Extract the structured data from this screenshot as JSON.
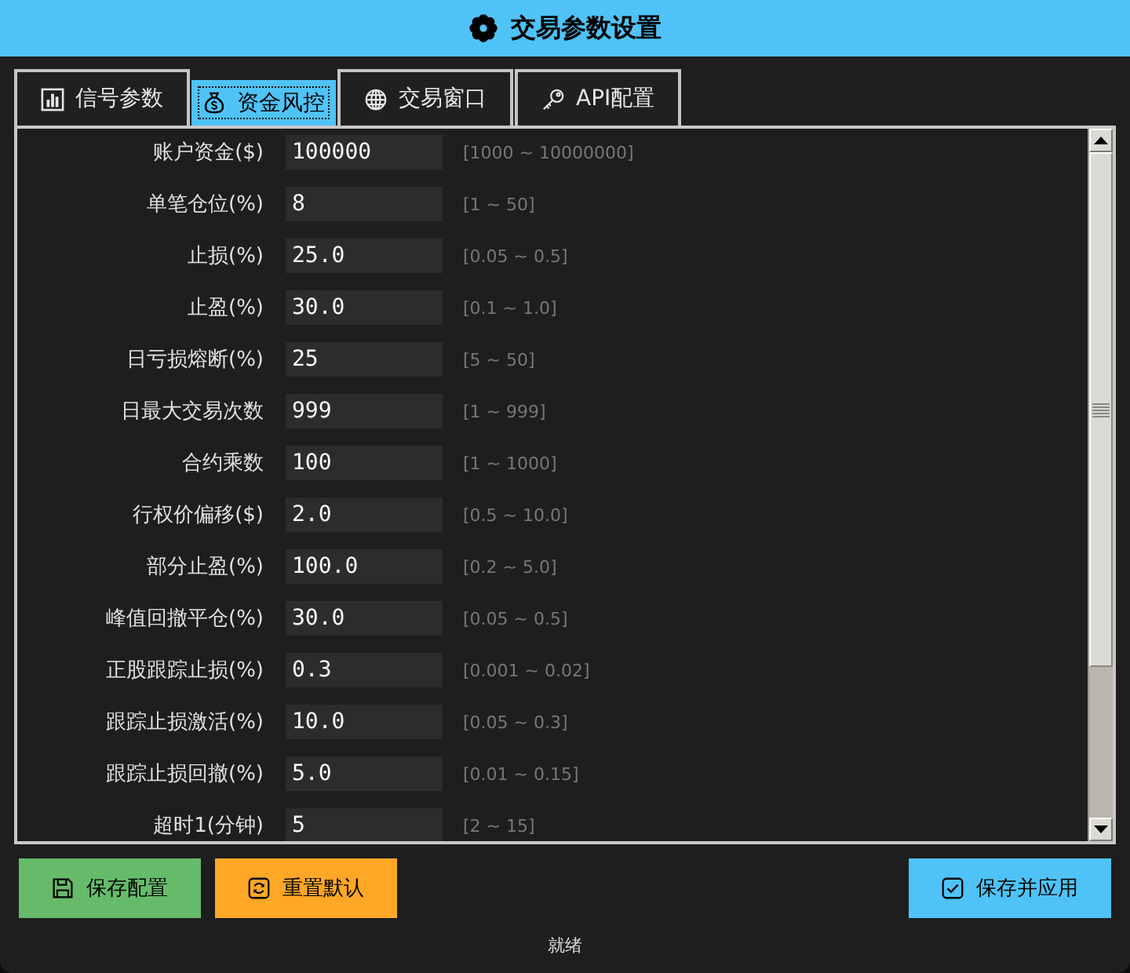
{
  "window": {
    "title": "交易参数设置"
  },
  "tabs": [
    {
      "label": "信号参数",
      "selected": false
    },
    {
      "label": "资金风控",
      "selected": true
    },
    {
      "label": "交易窗口",
      "selected": false
    },
    {
      "label": "API配置",
      "selected": false
    }
  ],
  "fields": [
    {
      "label": "账户资金($)",
      "value": "100000",
      "range": "[1000 ~ 10000000]"
    },
    {
      "label": "单笔仓位(%)",
      "value": "8",
      "range": "[1 ~ 50]"
    },
    {
      "label": "止损(%)",
      "value": "25.0",
      "range": "[0.05 ~ 0.5]"
    },
    {
      "label": "止盈(%)",
      "value": "30.0",
      "range": "[0.1 ~ 1.0]"
    },
    {
      "label": "日亏损熔断(%)",
      "value": "25",
      "range": "[5 ~ 50]"
    },
    {
      "label": "日最大交易次数",
      "value": "999",
      "range": "[1 ~ 999]"
    },
    {
      "label": "合约乘数",
      "value": "100",
      "range": "[1 ~ 1000]"
    },
    {
      "label": "行权价偏移($)",
      "value": "2.0",
      "range": "[0.5 ~ 10.0]"
    },
    {
      "label": "部分止盈(%)",
      "value": "100.0",
      "range": "[0.2 ~ 5.0]"
    },
    {
      "label": "峰值回撤平仓(%)",
      "value": "30.0",
      "range": "[0.05 ~ 0.5]"
    },
    {
      "label": "正股跟踪止损(%)",
      "value": "0.3",
      "range": "[0.001 ~ 0.02]"
    },
    {
      "label": "跟踪止损激活(%)",
      "value": "10.0",
      "range": "[0.05 ~ 0.3]"
    },
    {
      "label": "跟踪止损回撤(%)",
      "value": "5.0",
      "range": "[0.01 ~ 0.15]"
    },
    {
      "label": "超时1(分钟)",
      "value": "5",
      "range": "[2 ~ 15]"
    }
  ],
  "buttons": [
    {
      "label": "保存配置",
      "kind": "save"
    },
    {
      "label": "重置默认",
      "kind": "reset"
    },
    {
      "label": "保存并应用",
      "kind": "apply"
    }
  ],
  "status_bar": {
    "text": "就绪"
  }
}
